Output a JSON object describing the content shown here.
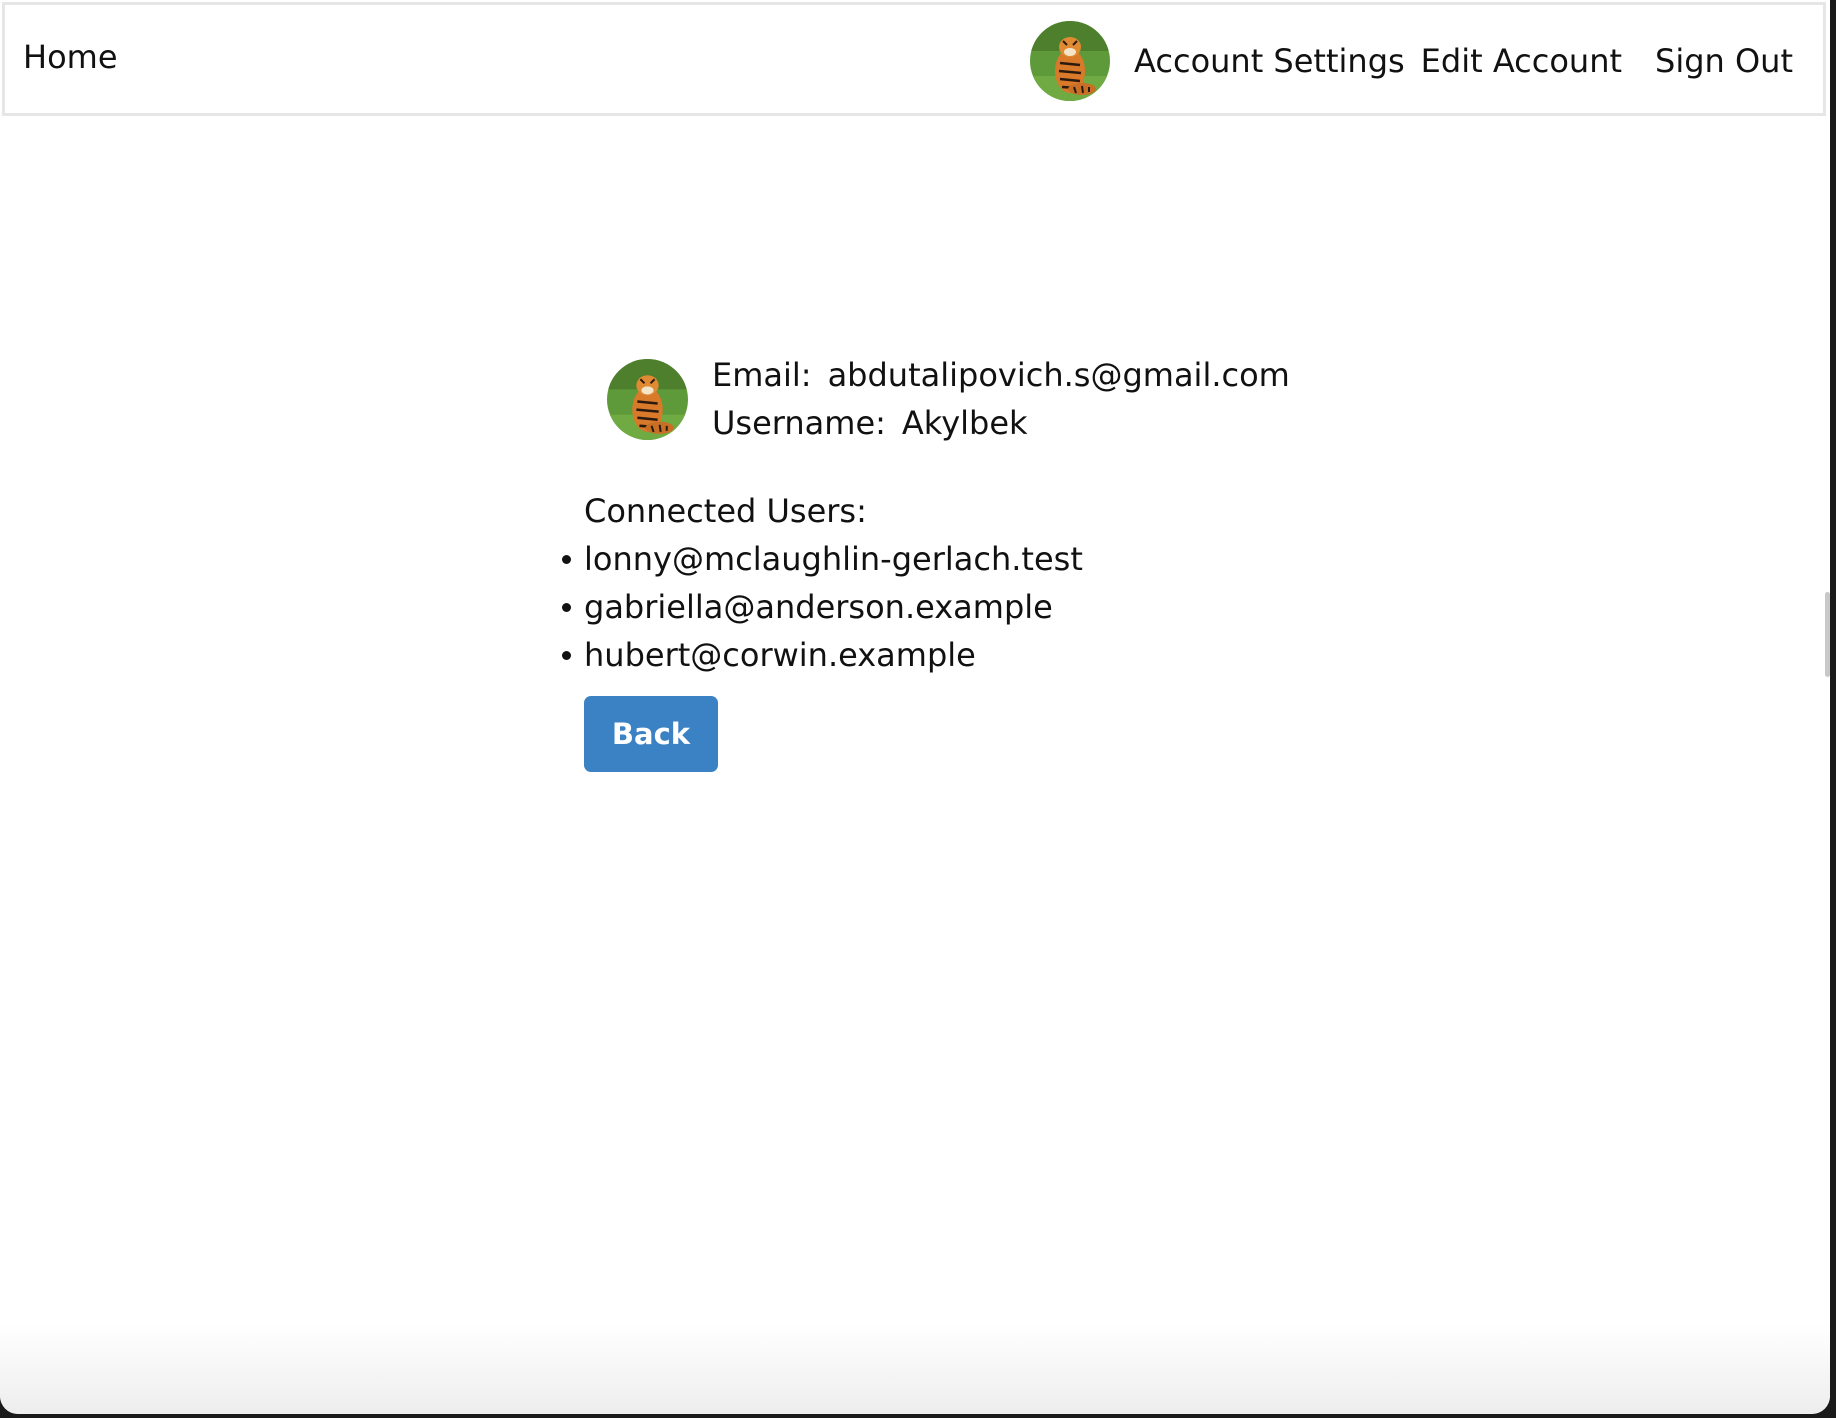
{
  "navbar": {
    "home_label": "Home",
    "account_settings_label": "Account Settings",
    "edit_account_label": "Edit Account",
    "sign_out_label": "Sign Out",
    "avatar_icon": "tiger-avatar-icon"
  },
  "profile": {
    "email_label": "Email:",
    "email_value": "abdutalipovich.s@gmail.com",
    "username_label": "Username:",
    "username_value": "Akylbek",
    "avatar_icon": "tiger-avatar-icon"
  },
  "connected_users": {
    "title": "Connected Users:",
    "items": [
      "lonny@mclaughlin-gerlach.test",
      "gabriella@anderson.example",
      "hubert@corwin.example"
    ]
  },
  "actions": {
    "back_label": "Back"
  },
  "colors": {
    "button_bg": "#3b82c4",
    "navbar_border": "#e6e6e6",
    "text": "#111111"
  }
}
